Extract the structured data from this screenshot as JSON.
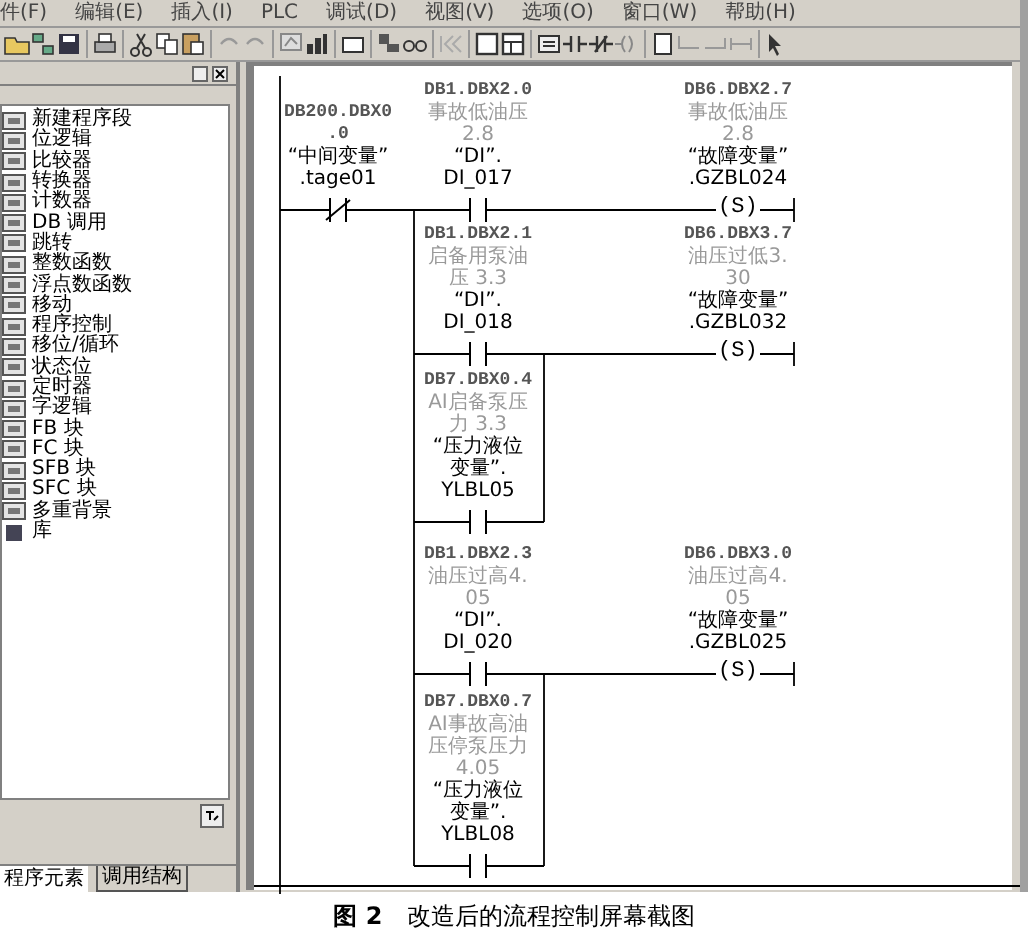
{
  "menu": [
    "件(F)",
    "编辑(E)",
    "插入(I)",
    "PLC",
    "调试(D)",
    "视图(V)",
    "选项(O)",
    "窗口(W)",
    "帮助(H)"
  ],
  "sidebar": {
    "items": [
      "新建程序段",
      "位逻辑",
      "比较器",
      "转换器",
      "计数器",
      "DB 调用",
      "跳转",
      "整数函数",
      "浮点数函数",
      "移动",
      "程序控制",
      "移位/循环",
      "状态位",
      "定时器",
      "字逻辑",
      "FB 块",
      "FC 块",
      "SFB 块",
      "SFC 块",
      "多重背景",
      "库"
    ],
    "tabs": [
      {
        "label": "程序元素",
        "selected": true
      },
      {
        "label": "调用结构",
        "selected": false
      }
    ]
  },
  "ladder": {
    "elements": [
      {
        "kind": "contact_nc",
        "lines": [
          {
            "kind": "address",
            "text": "DB200.DBX0"
          },
          {
            "kind": "address",
            "text": ".0"
          },
          {
            "kind": "symbol",
            "text": "“中间变量”"
          },
          {
            "kind": "symbol",
            "text": ".tage01"
          }
        ]
      },
      {
        "kind": "contact_no",
        "lines": [
          {
            "kind": "address",
            "text": "DB1.DBX2.0"
          },
          {
            "kind": "comment",
            "text": "事故低油压"
          },
          {
            "kind": "comment",
            "text": "2.8"
          },
          {
            "kind": "symbol",
            "text": "“DI”."
          },
          {
            "kind": "symbol",
            "text": "DI_017"
          }
        ]
      },
      {
        "kind": "coil",
        "coil_text": "(S)",
        "lines": [
          {
            "kind": "address",
            "text": "DB6.DBX2.7"
          },
          {
            "kind": "comment",
            "text": "事故低油压"
          },
          {
            "kind": "comment",
            "text": "2.8"
          },
          {
            "kind": "symbol",
            "text": "“故障变量”"
          },
          {
            "kind": "symbol",
            "text": ".GZBL024"
          }
        ]
      },
      {
        "kind": "contact_no",
        "lines": [
          {
            "kind": "address",
            "text": "DB1.DBX2.1"
          },
          {
            "kind": "comment",
            "text": "启备用泵油"
          },
          {
            "kind": "comment",
            "text": "压 3.3"
          },
          {
            "kind": "symbol",
            "text": "“DI”."
          },
          {
            "kind": "symbol",
            "text": "DI_018"
          }
        ]
      },
      {
        "kind": "coil",
        "coil_text": "(S)",
        "lines": [
          {
            "kind": "address",
            "text": "DB6.DBX3.7"
          },
          {
            "kind": "comment",
            "text": "油压过低3."
          },
          {
            "kind": "comment",
            "text": "30"
          },
          {
            "kind": "symbol",
            "text": "“故障变量”"
          },
          {
            "kind": "symbol",
            "text": ".GZBL032"
          }
        ]
      },
      {
        "kind": "contact_no",
        "lines": [
          {
            "kind": "address",
            "text": "DB7.DBX0.4"
          },
          {
            "kind": "comment",
            "text": "AI启备泵压"
          },
          {
            "kind": "comment",
            "text": "力 3.3"
          },
          {
            "kind": "symbol",
            "text": "“压力液位"
          },
          {
            "kind": "symbol",
            "text": "变量”."
          },
          {
            "kind": "symbol",
            "text": "YLBL05"
          }
        ]
      },
      {
        "kind": "contact_no",
        "lines": [
          {
            "kind": "address",
            "text": "DB1.DBX2.3"
          },
          {
            "kind": "comment",
            "text": "油压过高4."
          },
          {
            "kind": "comment",
            "text": "05"
          },
          {
            "kind": "symbol",
            "text": "“DI”."
          },
          {
            "kind": "symbol",
            "text": "DI_020"
          }
        ]
      },
      {
        "kind": "coil",
        "coil_text": "(S)",
        "lines": [
          {
            "kind": "address",
            "text": "DB6.DBX3.0"
          },
          {
            "kind": "comment",
            "text": "油压过高4."
          },
          {
            "kind": "comment",
            "text": "05"
          },
          {
            "kind": "symbol",
            "text": "“故障变量”"
          },
          {
            "kind": "symbol",
            "text": ".GZBL025"
          }
        ]
      },
      {
        "kind": "contact_no",
        "lines": [
          {
            "kind": "address",
            "text": "DB7.DBX0.7"
          },
          {
            "kind": "comment",
            "text": "AI事故高油"
          },
          {
            "kind": "comment",
            "text": "压停泵压力"
          },
          {
            "kind": "comment",
            "text": "4.05"
          },
          {
            "kind": "symbol",
            "text": "“压力液位"
          },
          {
            "kind": "symbol",
            "text": "变量”."
          },
          {
            "kind": "symbol",
            "text": "YLBL08"
          }
        ]
      }
    ]
  },
  "caption": {
    "label": "图 2",
    "text": "改造后的流程控制屏幕截图"
  }
}
